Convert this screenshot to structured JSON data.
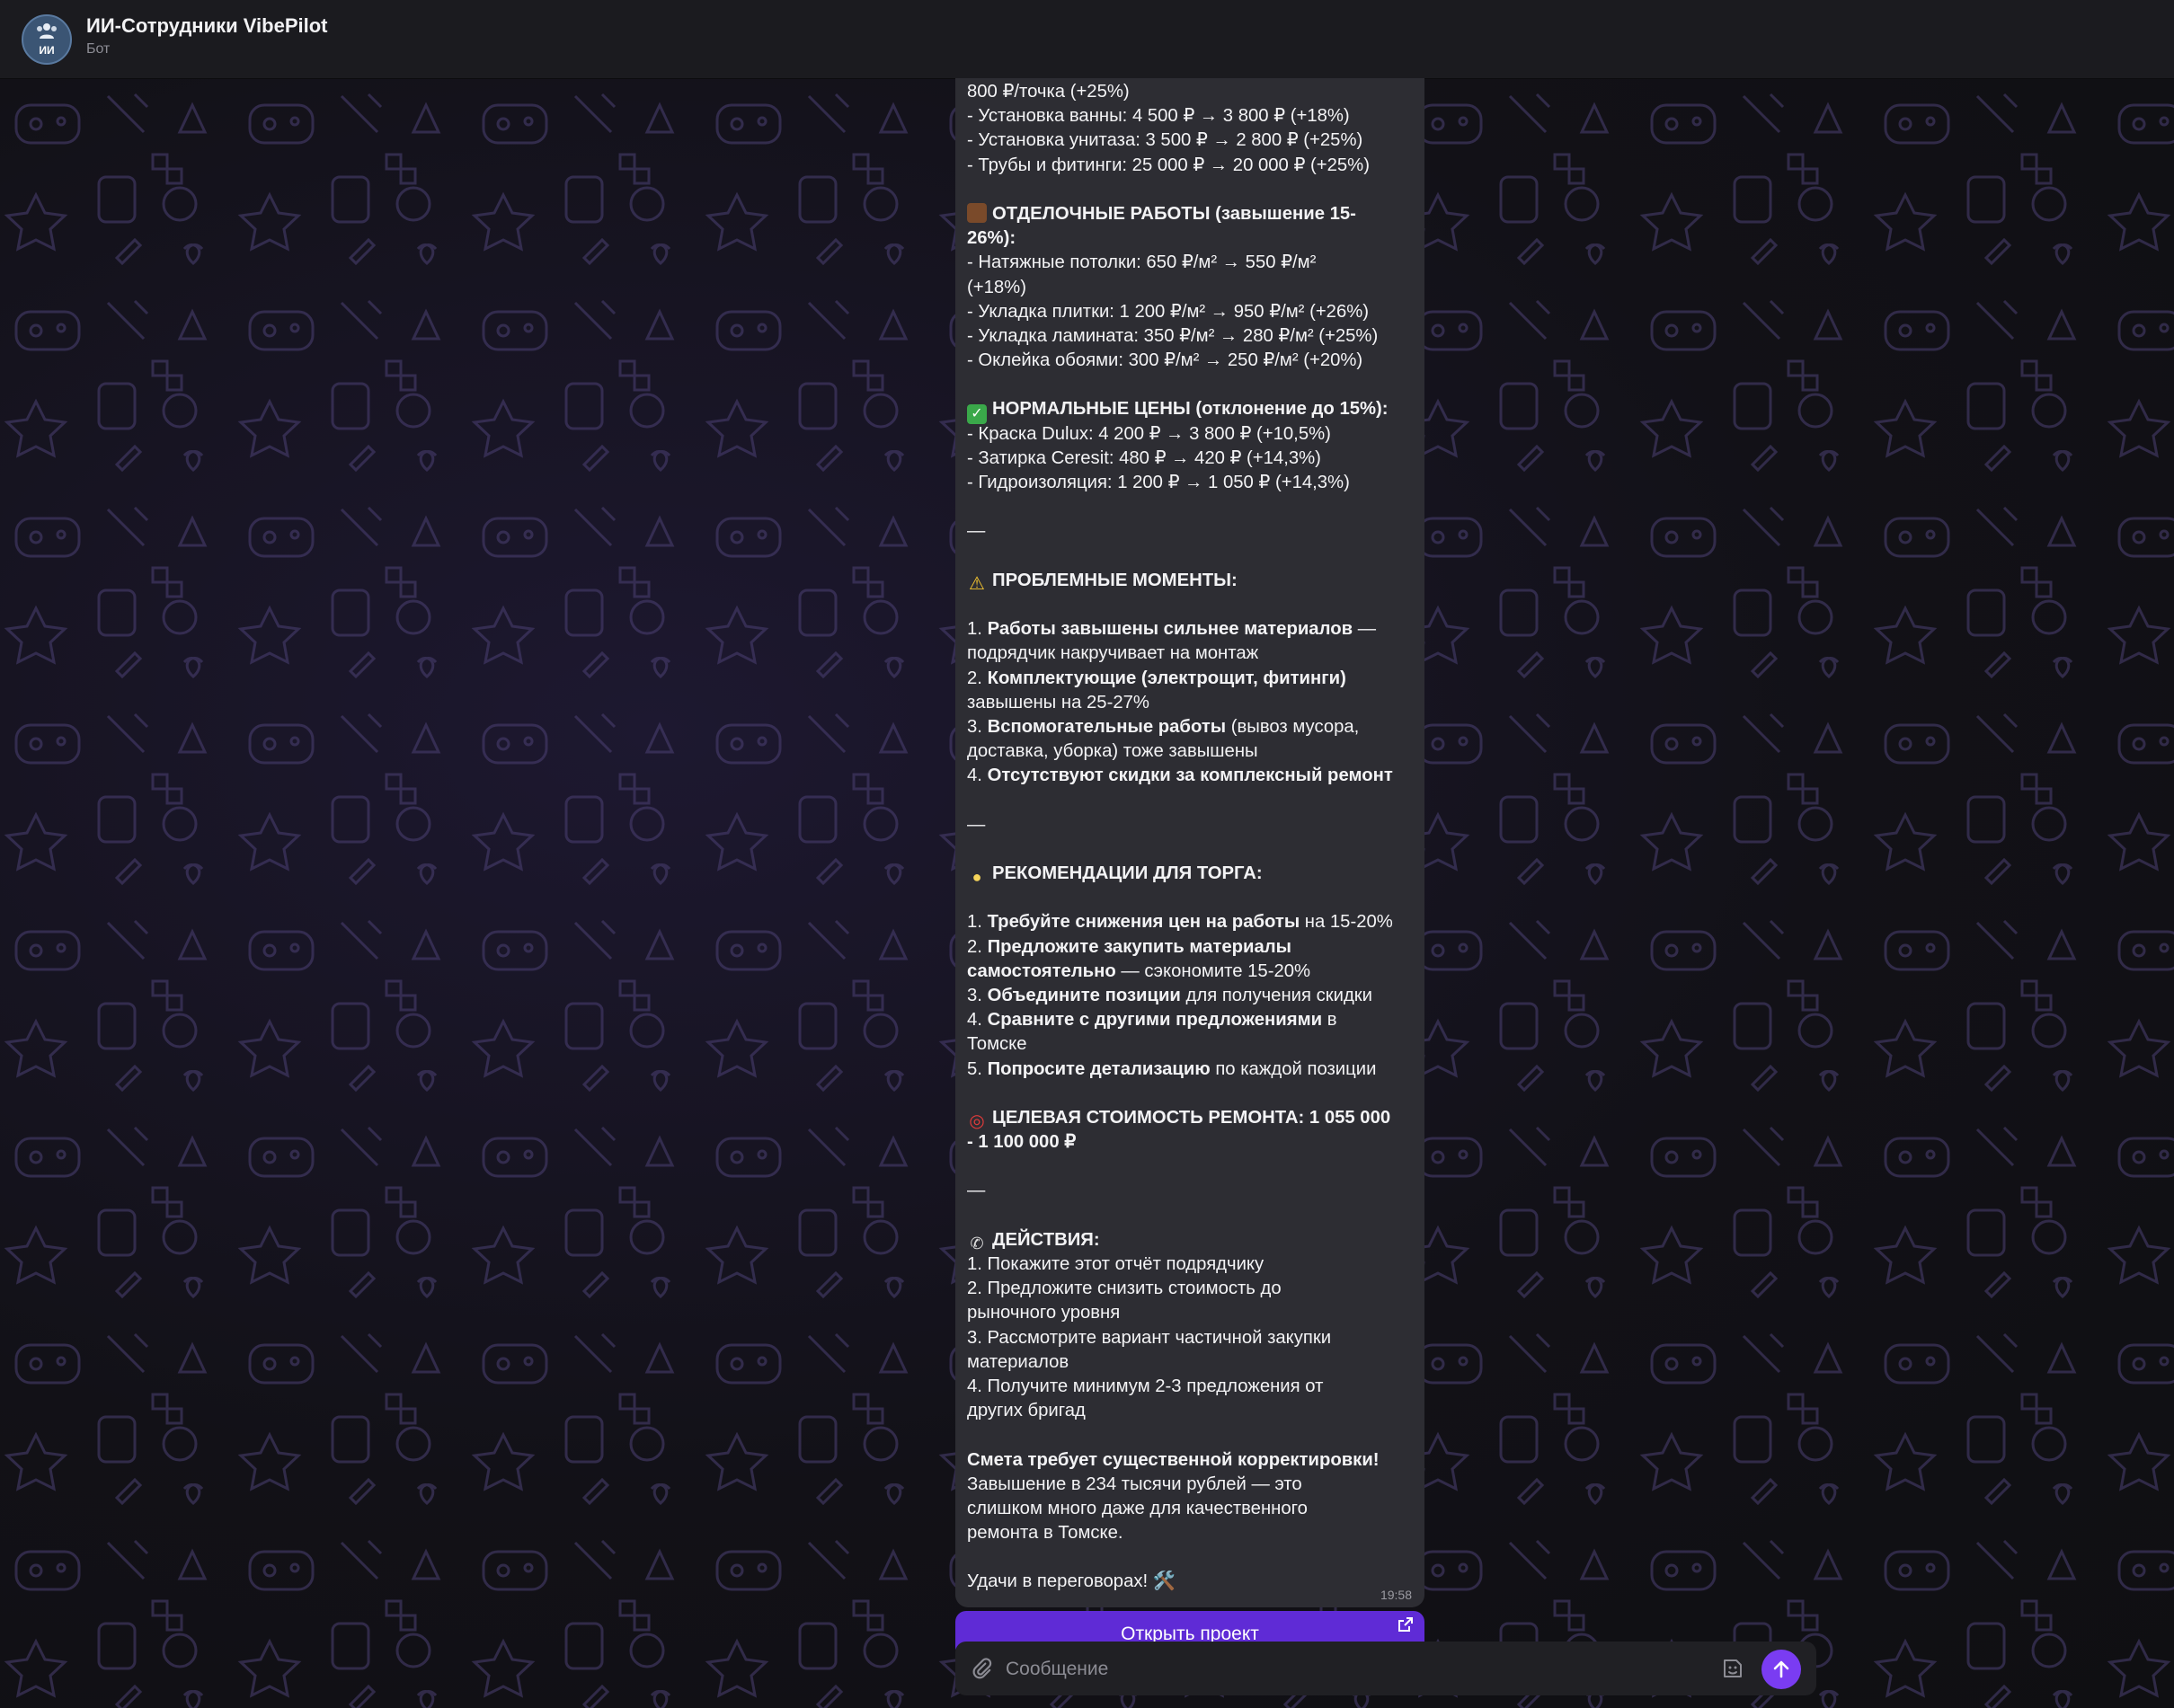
{
  "header": {
    "title": "ИИ-Сотрудники VibePilot",
    "subtitle": "Бот",
    "avatar_abbr": "ИИ",
    "avatar_icon": "group-icon"
  },
  "message": {
    "time": "19:58",
    "lines": {
      "l0": "800 ₽/точка (+25%)",
      "l1": "- Установка ванны: 4 500 ₽ → 3 800 ₽ (+18%)",
      "l2": "- Установка унитаза: 3 500 ₽ → 2 800 ₽ (+25%)",
      "l3": "- Трубы и фитинги: 25 000 ₽ → 20 000 ₽ (+25%)",
      "finish_head_1": "ОТДЕЛОЧНЫЕ РАБОТЫ (завышение 15-",
      "finish_head_2": "26%):",
      "f1a": "- Натяжные потолки: 650 ₽/м² → 550 ₽/м²",
      "f1b": "(+18%)",
      "f2": "- Укладка плитки: 1 200 ₽/м² → 950 ₽/м² (+26%)",
      "f3": "- Укладка ламината: 350 ₽/м² → 280 ₽/м² (+25%)",
      "f4": "- Оклейка обоями: 300 ₽/м² → 250 ₽/м² (+20%)",
      "normal_head": "НОРМАЛЬНЫЕ ЦЕНЫ (отклонение до 15%):",
      "n1": "- Краска Dulux: 4 200 ₽ → 3 800 ₽ (+10,5%)",
      "n2": "- Затирка Ceresit: 480 ₽ → 420 ₽ (+14,3%)",
      "n3": "- Гидроизоляция: 1 200 ₽ → 1 050 ₽ (+14,3%)",
      "dash": "—",
      "problems_head": "ПРОБЛЕМНЫЕ МОМЕНТЫ:",
      "p1_num": "1. ",
      "p1_bold": "Работы завышены сильнее материалов",
      "p1_rest": " —",
      "p1_b": "подрядчик накручивает на монтаж",
      "p2_num": "2. ",
      "p2_bold": "Комплектующие (электрощит, фитинги)",
      "p2_b": "завышены на 25-27%",
      "p3_num": "3. ",
      "p3_bold": "Вспомогательные работы",
      "p3_rest": " (вывоз мусора,",
      "p3_b": "доставка, уборка) тоже завышены",
      "p4_num": "4. ",
      "p4_bold": "Отсутствуют скидки за комплексный ремонт",
      "rec_head": "РЕКОМЕНДАЦИИ ДЛЯ ТОРГА:",
      "r1_num": "1. ",
      "r1_bold": "Требуйте снижения цен на работы",
      "r1_rest": " на 15-20%",
      "r2_num": "2. ",
      "r2_bold": "Предложите закупить материалы",
      "r2_b_bold": "самостоятельно",
      "r2_b_rest": " — сэкономите 15-20%",
      "r3_num": "3. ",
      "r3_bold": "Объедините позиции",
      "r3_rest": " для получения скидки",
      "r4_num": "4. ",
      "r4_bold": "Сравните с другими предложениями",
      "r4_rest": " в",
      "r4_b": "Томске",
      "r5_num": "5. ",
      "r5_bold": "Попросите детализацию",
      "r5_rest": " по каждой позиции",
      "target_1": "ЦЕЛЕВАЯ СТОИМОСТЬ РЕМОНТА: 1 055 000",
      "target_2": "- 1 100 000 ₽",
      "actions_head": "ДЕЙСТВИЯ:",
      "a1": "1. Покажите этот отчёт подрядчику",
      "a2a": "2. Предложите снизить стоимость до",
      "a2b": "рыночного уровня",
      "a3a": "3. Рассмотрите вариант частичной закупки",
      "a3b": "материалов",
      "a4a": "4. Получите минимум 2-3 предложения от",
      "a4b": "других бригад",
      "sum_bold": "Смета требует существенной корректировки!",
      "sum_1": "Завышение в 234 тысячи рублей — это",
      "sum_2": "слишком много даже для качественного",
      "sum_3": "ремонта в Томске.",
      "bye": "Удачи в переговорах! 🛠️"
    }
  },
  "inline_button": {
    "label": "Открыть проект",
    "icon": "external-link-icon"
  },
  "composer": {
    "placeholder": "Сообщение",
    "attach_icon": "paperclip-icon",
    "sticker_icon": "sticker-icon",
    "send_icon": "send-arrow-icon"
  },
  "colors": {
    "accent": "#7a3cf2",
    "button": "#5f2bd6",
    "bubble": "#2d2d33",
    "header": "#1b1b1f"
  }
}
